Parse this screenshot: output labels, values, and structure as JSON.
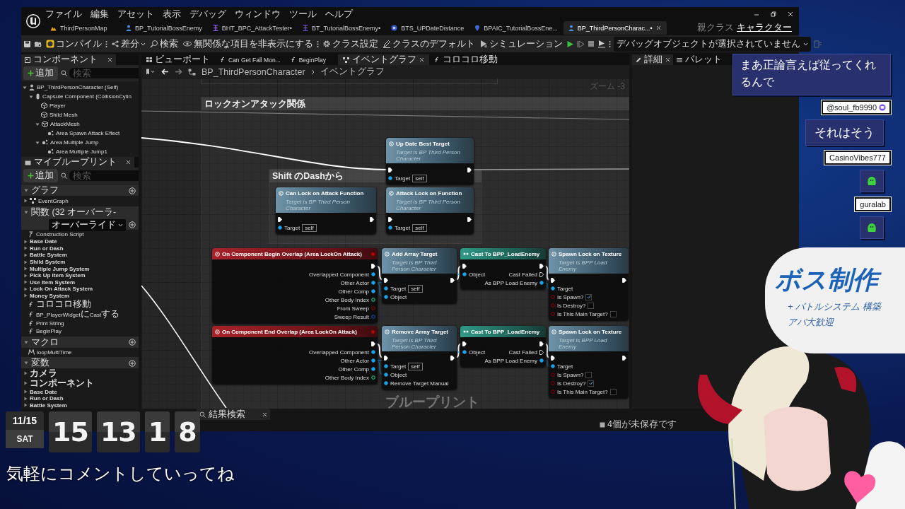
{
  "editor": {
    "menu": [
      "ファイル",
      "編集",
      "アセット",
      "表示",
      "デバッグ",
      "ウィンドウ",
      "ツール",
      "ヘルプ"
    ],
    "doc_tabs": [
      {
        "kind": "map",
        "label": "ThirdPersonMap",
        "selected": false
      },
      {
        "kind": "actor",
        "label": "BP_TutorialBossEnemy",
        "selected": false
      },
      {
        "kind": "task",
        "label": "BHT_BPC_AttackTester•",
        "selected": false
      },
      {
        "kind": "tree",
        "label": "BT_TutorialBossEnemy•",
        "selected": false
      },
      {
        "kind": "service",
        "label": "BTS_UPDateDistance",
        "selected": false
      },
      {
        "kind": "controller",
        "label": "BPAIC_TutorialBossEne...",
        "selected": false
      },
      {
        "kind": "actor",
        "label": "BP_ThirdPersonCharac...•",
        "selected": true
      }
    ],
    "parent_class": {
      "label": "親クラス",
      "value": "キャラクター"
    },
    "toolbar": [
      {
        "kind": "save"
      },
      {
        "kind": "browse"
      },
      {
        "kind": "compile",
        "label": "コンパイル"
      },
      {
        "kind": "more"
      },
      {
        "kind": "diff",
        "label": "差分"
      },
      {
        "kind": "find",
        "label": "検索"
      },
      {
        "kind": "hide",
        "label": "無関係な項目を非表示にする"
      },
      {
        "kind": "more"
      },
      {
        "kind": "class_settings",
        "label": "クラス設定"
      },
      {
        "kind": "class_defaults",
        "label": "クラスのデフォルト"
      },
      {
        "kind": "simulation",
        "label": "シミュレーション"
      },
      {
        "kind": "play"
      },
      {
        "kind": "step"
      },
      {
        "kind": "stop"
      },
      {
        "kind": "eject"
      },
      {
        "kind": "more"
      },
      {
        "kind": "debug",
        "label": "デバッグオブジェクトが選択されていません"
      },
      {
        "kind": "debug_options"
      }
    ],
    "components_panel": {
      "title": "コンポーネント",
      "add": "追加",
      "search_placeholder": "検索",
      "tree": [
        {
          "kind": "actor",
          "label": "BP_ThirdPersonCharacter (Self)",
          "expanded": true,
          "children": [
            {
              "kind": "capsule",
              "label": "Capsule Component (CollisionCylin",
              "expanded": true,
              "children": [
                {
                  "kind": "mesh",
                  "label": "Player"
                },
                {
                  "kind": "mesh",
                  "label": "Shild Mesh"
                },
                {
                  "kind": "mesh",
                  "label": "AttackMesh",
                  "expanded": true,
                  "children": [
                    {
                      "kind": "effect",
                      "label": "Area Spawn Attack Effect"
                    }
                  ]
                },
                {
                  "kind": "effect",
                  "label": "Area Multiple Jump",
                  "expanded": true,
                  "children": [
                    {
                      "kind": "effect",
                      "label": "Area Multiple Jump1"
                    }
                  ]
                }
              ]
            }
          ]
        }
      ]
    },
    "my_blueprint": {
      "title": "マイブループリント",
      "add": "追加",
      "search_placeholder": "検索",
      "sections": [
        {
          "title": "グラフ",
          "items": [
            {
              "kind": "graph",
              "label": "EventGraph"
            }
          ]
        },
        {
          "title": "関数 (32 オーバーラ-",
          "override": "オーバーライド",
          "items": [
            {
              "kind": "construction",
              "label": "Construction Script"
            },
            {
              "kind": "category",
              "label": "Base Date"
            },
            {
              "kind": "category",
              "label": "Run or Dash"
            },
            {
              "kind": "category",
              "label": "Battle System"
            },
            {
              "kind": "category",
              "label": "Shild System"
            },
            {
              "kind": "category",
              "label": "Multiple Jump System"
            },
            {
              "kind": "category",
              "label": "Pick Up Item System"
            },
            {
              "kind": "category",
              "label": "Use Item System"
            },
            {
              "kind": "category",
              "label": "Lock On Attack System"
            },
            {
              "kind": "category",
              "label": "Money System"
            },
            {
              "kind": "function",
              "label": "コロコロ移動"
            },
            {
              "kind": "function",
              "label": "BP_PlayerWidgetにCastする"
            },
            {
              "kind": "function",
              "label": "Print String"
            },
            {
              "kind": "function",
              "label": "BeginPlay"
            }
          ]
        },
        {
          "title": "マクロ",
          "items": [
            {
              "kind": "macro",
              "label": "loopMultiTime"
            }
          ]
        },
        {
          "title": "変数",
          "items": [
            {
              "kind": "category",
              "label": "カメラ"
            },
            {
              "kind": "category",
              "label": "コンポーネント"
            },
            {
              "kind": "category",
              "label": "Base Date"
            },
            {
              "kind": "category",
              "label": "Run or Dash"
            },
            {
              "kind": "category",
              "label": "Battle System"
            }
          ]
        }
      ]
    },
    "graph_tabs": [
      {
        "kind": "viewport",
        "label": "ビューポート",
        "selected": false
      },
      {
        "kind": "function",
        "label": "Can Get Fall Mon...",
        "selected": false
      },
      {
        "kind": "function",
        "label": "BeginPlay",
        "selected": false
      },
      {
        "kind": "graph",
        "label": "イベントグラフ",
        "selected": true
      },
      {
        "kind": "function",
        "label": "コロコロ移動",
        "selected": false
      }
    ],
    "breadcrumb": [
      "BP_ThirdPersonCharacter",
      "イベントグラフ"
    ],
    "zoom": "ズーム -3",
    "watermark": "ブループリント",
    "comments": [
      {
        "title": "ロックオンアタック関係"
      },
      {
        "title": "Shift のDashから"
      }
    ],
    "nodes": [
      {
        "kind": "function",
        "title": "Up Date Best Target",
        "subtitle": "Target is BP Third Person Character",
        "inputs": [
          {
            "kind": "exec"
          },
          {
            "kind": "object",
            "label": "Target",
            "value": "self"
          }
        ],
        "outputs": [
          {
            "kind": "exec"
          }
        ]
      },
      {
        "kind": "function",
        "title": "Can Lock on Attack Function",
        "subtitle": "Target is BP Third Person Character",
        "inputs": [
          {
            "kind": "exec"
          },
          {
            "kind": "object",
            "label": "Target",
            "value": "self"
          }
        ],
        "outputs": [
          {
            "kind": "exec"
          }
        ]
      },
      {
        "kind": "function",
        "title": "Attack Lock on Function",
        "subtitle": "Target is BP Third Person Character",
        "inputs": [
          {
            "kind": "exec"
          },
          {
            "kind": "object",
            "label": "Target",
            "value": "self"
          }
        ],
        "outputs": [
          {
            "kind": "exec"
          }
        ]
      },
      {
        "kind": "event",
        "title": "On Component Begin Overlap (Area LockOn Attack)",
        "outputs": [
          {
            "kind": "exec"
          },
          {
            "kind": "object",
            "label": "Overlapped Component"
          },
          {
            "kind": "object",
            "label": "Other Actor"
          },
          {
            "kind": "object",
            "label": "Other Comp"
          },
          {
            "kind": "int",
            "label": "Other Body Index"
          },
          {
            "kind": "bool",
            "label": "From Sweep"
          },
          {
            "kind": "struct",
            "label": "Sweep Result"
          }
        ]
      },
      {
        "kind": "function",
        "title": "Add Array Target",
        "subtitle": "Target is BP Third Person Character",
        "inputs": [
          {
            "kind": "exec"
          },
          {
            "kind": "object",
            "label": "Target",
            "value": "self"
          },
          {
            "kind": "object",
            "label": "Object"
          }
        ],
        "outputs": [
          {
            "kind": "exec"
          }
        ]
      },
      {
        "kind": "cast",
        "title": "Cast To BPP_LoadEnemy",
        "inputs": [
          {
            "kind": "exec"
          },
          {
            "kind": "object",
            "label": "Object"
          }
        ],
        "outputs": [
          {
            "kind": "exec"
          },
          {
            "kind": "exec",
            "label": "Cast Failed"
          },
          {
            "kind": "object",
            "label": "As BPP Load Enemy"
          }
        ]
      },
      {
        "kind": "function",
        "title": "Spawn Lock on Texture",
        "subtitle": "Target is BPP Load Enemy",
        "inputs": [
          {
            "kind": "exec"
          },
          {
            "kind": "object",
            "label": "Target"
          },
          {
            "kind": "bool",
            "label": "Is Spawn?",
            "checked": true
          },
          {
            "kind": "bool",
            "label": "Is Destroy?",
            "checked": false
          },
          {
            "kind": "bool",
            "label": "Is This Main Target?",
            "checked": false
          }
        ],
        "outputs": [
          {
            "kind": "exec"
          }
        ]
      },
      {
        "kind": "event",
        "title": "On Component End Overlap (Area LockOn Attack)",
        "outputs": [
          {
            "kind": "exec"
          },
          {
            "kind": "object",
            "label": "Overlapped Component"
          },
          {
            "kind": "object",
            "label": "Other Actor"
          },
          {
            "kind": "object",
            "label": "Other Comp"
          },
          {
            "kind": "int",
            "label": "Other Body Index"
          }
        ]
      },
      {
        "kind": "function",
        "title": "Remove Array Target",
        "subtitle": "Target is BP Third Person Character",
        "inputs": [
          {
            "kind": "exec"
          },
          {
            "kind": "object",
            "label": "Target",
            "value": "self"
          },
          {
            "kind": "object",
            "label": "Object"
          },
          {
            "kind": "object",
            "label": "Remove Target Manual"
          }
        ],
        "outputs": [
          {
            "kind": "exec"
          }
        ]
      },
      {
        "kind": "cast",
        "title": "Cast To BPP_LoadEnemy",
        "inputs": [
          {
            "kind": "exec"
          },
          {
            "kind": "object",
            "label": "Object"
          }
        ],
        "outputs": [
          {
            "kind": "exec"
          },
          {
            "kind": "exec",
            "label": "Cast Failed"
          },
          {
            "kind": "object",
            "label": "As BPP Load Enemy"
          }
        ]
      },
      {
        "kind": "function",
        "title": "Spawn Lock on Texture",
        "subtitle": "Target is BPP Load Enemy",
        "inputs": [
          {
            "kind": "exec"
          },
          {
            "kind": "object",
            "label": "Target"
          },
          {
            "kind": "bool",
            "label": "Is Spawn?",
            "checked": false
          },
          {
            "kind": "bool",
            "label": "Is Destroy?",
            "checked": true
          },
          {
            "kind": "bool",
            "label": "Is This Main Target?",
            "checked": false
          }
        ],
        "outputs": [
          {
            "kind": "exec"
          }
        ]
      }
    ],
    "side_tabs": [
      {
        "label": "詳細",
        "selected": true
      },
      {
        "label": "パレット",
        "selected": false
      }
    ],
    "bottom_tab": "結果検索",
    "status": "4個が未保存です"
  },
  "clock": {
    "date": "11/15",
    "weekday": "SAT",
    "digits": [
      "15",
      "13",
      "1",
      "8"
    ]
  },
  "caption": "気軽にコメントしていってね",
  "chat": [
    {
      "kind": "text",
      "text": "まあ正論言えば従ってくれるんで"
    },
    {
      "kind": "text",
      "user": "@soul_fb9990",
      "member_badge": true,
      "text": "それはそう"
    },
    {
      "kind": "sticker",
      "user": "CasinoVibes777",
      "member_badge": false
    },
    {
      "kind": "sticker",
      "user": "guralab",
      "member_badge": false
    }
  ],
  "whiteboard": {
    "title": "ボス制作",
    "lines": [
      "+ バトルシステム 構築",
      "アバ大歓迎"
    ]
  }
}
